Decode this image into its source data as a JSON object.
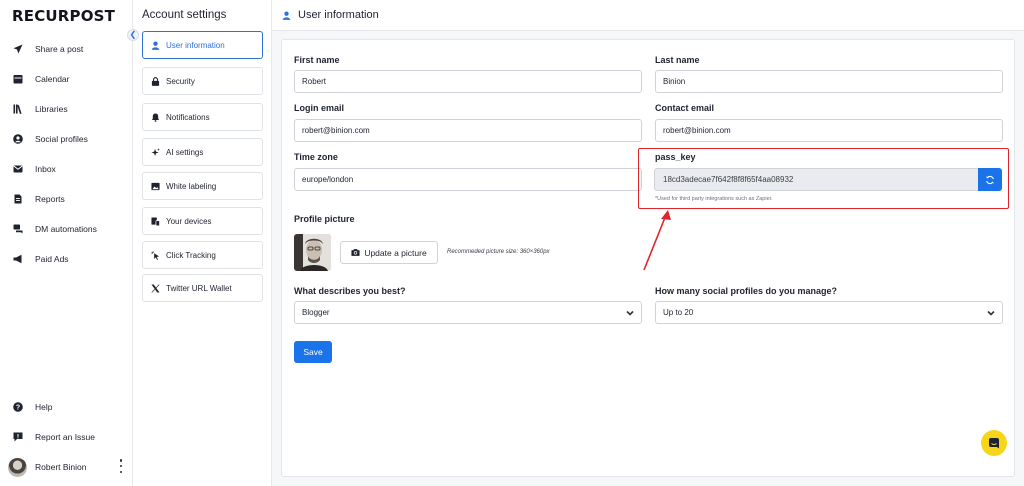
{
  "brand": {
    "logo_text": "RECURPOST",
    "accent": "#1a73e8",
    "highlight": "#e0242a",
    "chat_color": "#f7d51b"
  },
  "nav": {
    "items": [
      {
        "label": "Share a post",
        "icon": "send-icon"
      },
      {
        "label": "Calendar",
        "icon": "calendar-icon"
      },
      {
        "label": "Libraries",
        "icon": "library-icon"
      },
      {
        "label": "Social profiles",
        "icon": "user-circle-icon"
      },
      {
        "label": "Inbox",
        "icon": "inbox-icon"
      },
      {
        "label": "Reports",
        "icon": "report-icon"
      },
      {
        "label": "DM automations",
        "icon": "chat-icon"
      },
      {
        "label": "Paid Ads",
        "icon": "megaphone-icon"
      }
    ],
    "bottom": [
      {
        "label": "Help",
        "icon": "help-icon"
      },
      {
        "label": "Report an Issue",
        "icon": "flag-icon"
      }
    ],
    "user_name": "Robert Binion"
  },
  "settings": {
    "title": "Account settings",
    "items": [
      {
        "label": "User information",
        "icon": "user-icon",
        "active": true
      },
      {
        "label": "Security",
        "icon": "lock-icon"
      },
      {
        "label": "Notifications",
        "icon": "bell-icon"
      },
      {
        "label": "AI settings",
        "icon": "sparkle-icon"
      },
      {
        "label": "White labeling",
        "icon": "image-icon"
      },
      {
        "label": "Your devices",
        "icon": "devices-icon"
      },
      {
        "label": "Click Tracking",
        "icon": "cursor-icon"
      },
      {
        "label": "Twitter URL Wallet",
        "icon": "x-logo-icon"
      }
    ]
  },
  "header": {
    "title": "User information"
  },
  "form": {
    "first_name": {
      "label": "First name",
      "value": "Robert"
    },
    "last_name": {
      "label": "Last name",
      "value": "Binion"
    },
    "login_email": {
      "label": "Login email",
      "value": "robert@binion.com"
    },
    "contact_email": {
      "label": "Contact email",
      "value": "robert@binion.com"
    },
    "time_zone": {
      "label": "Time zone",
      "value": "europe/london"
    },
    "pass_key": {
      "label": "pass_key",
      "value": "18cd3adecae7f642f8f8f65f4aa08932",
      "help": "*Used for third party integrations such as Zapier."
    },
    "profile_picture": {
      "label": "Profile picture",
      "button": "Update a picture",
      "size_note": "Recommeded picture size: 360×360px"
    },
    "describes": {
      "label": "What describes you best?",
      "value": "Blogger"
    },
    "profiles_count": {
      "label": "How many social profiles do you manage?",
      "value": "Up to 20"
    },
    "save_label": "Save"
  }
}
